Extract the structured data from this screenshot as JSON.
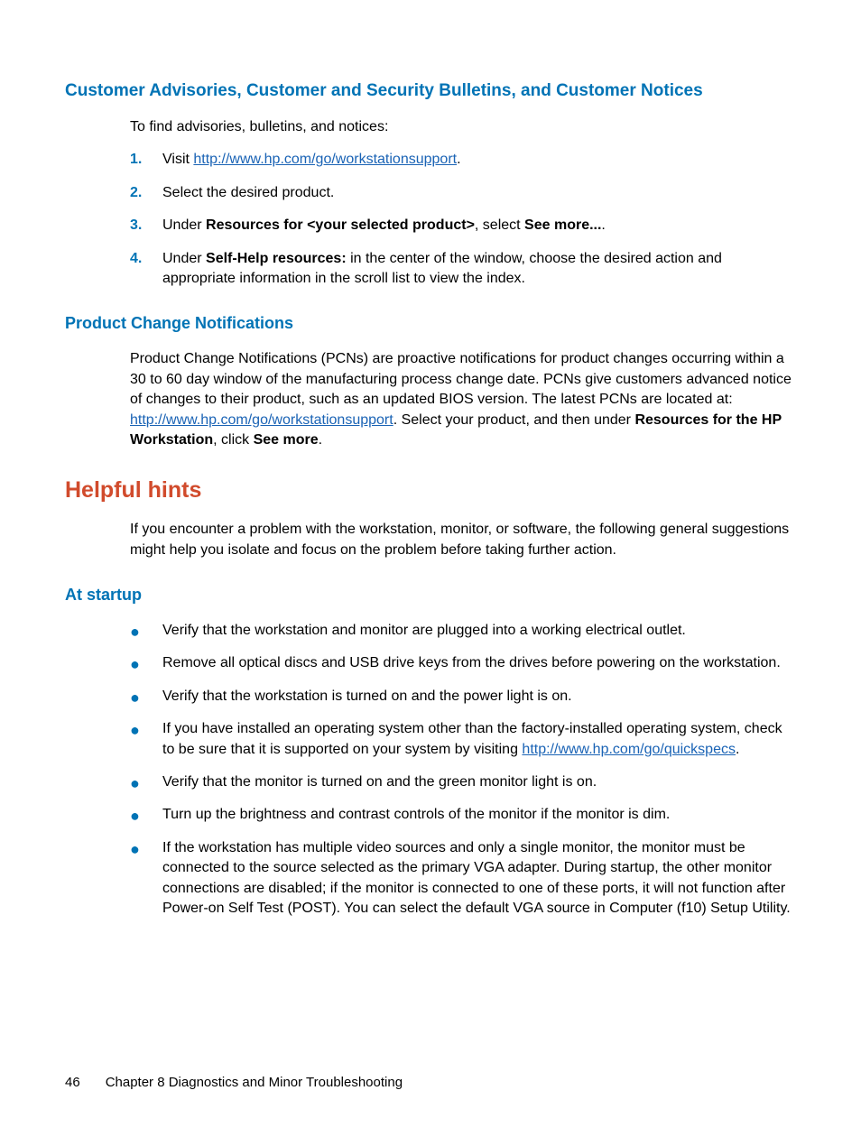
{
  "section1": {
    "heading": "Customer Advisories, Customer and Security Bulletins, and Customer Notices",
    "intro": "To find advisories, bulletins, and notices:",
    "steps": {
      "s1_prefix": "Visit ",
      "s1_link": "http://www.hp.com/go/workstationsupport",
      "s1_suffix": ".",
      "s2": "Select the desired product.",
      "s3_prefix": "Under ",
      "s3_bold1": "Resources for <your selected product>",
      "s3_mid": ", select ",
      "s3_bold2": "See more...",
      "s3_suffix": ".",
      "s4_prefix": "Under ",
      "s4_bold": "Self-Help resources:",
      "s4_suffix": " in the center of the window, choose the desired action and appropriate information in the scroll list to view the index."
    }
  },
  "section2": {
    "heading": "Product Change Notifications",
    "para_pre": "Product Change Notifications (PCNs) are proactive notifications for product changes occurring within a 30 to 60 day window of the manufacturing process change date. PCNs give customers advanced notice of changes to their product, such as an updated BIOS version. The latest PCNs are located at: ",
    "para_link": "http://www.hp.com/go/workstationsupport",
    "para_mid": ". Select your product, and then under ",
    "para_bold1": "Resources for the HP Workstation",
    "para_mid2": ", click ",
    "para_bold2": "See more",
    "para_suffix": "."
  },
  "section3": {
    "heading": "Helpful hints",
    "intro": "If you encounter a problem with the workstation, monitor, or software, the following general suggestions might help you isolate and focus on the problem before taking further action."
  },
  "section4": {
    "heading": "At startup",
    "bullets": {
      "b1": "Verify that the workstation and monitor are plugged into a working electrical outlet.",
      "b2": "Remove all optical discs and USB drive keys from the drives before powering on the workstation.",
      "b3": "Verify that the workstation is turned on and the power light is on.",
      "b4_pre": "If you have installed an operating system other than the factory-installed operating system, check to be sure that it is supported on your system by visiting ",
      "b4_link": "http://www.hp.com/go/quickspecs",
      "b4_suffix": ".",
      "b5": "Verify that the monitor is turned on and the green monitor light is on.",
      "b6": "Turn up the brightness and contrast controls of the monitor if the monitor is dim.",
      "b7": "If the workstation has multiple video sources and only a single monitor, the monitor must be connected to the source selected as the primary VGA adapter. During startup, the other monitor connections are disabled; if the monitor is connected to one of these ports, it will not function after Power-on Self Test (POST). You can select the default VGA source in Computer (f10) Setup Utility."
    }
  },
  "footer": {
    "page": "46",
    "chapter": "Chapter 8   Diagnostics and Minor Troubleshooting"
  },
  "nums": {
    "n1": "1.",
    "n2": "2.",
    "n3": "3.",
    "n4": "4."
  }
}
